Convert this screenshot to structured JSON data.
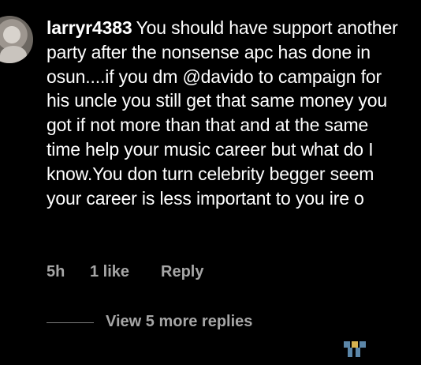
{
  "comment": {
    "username": "larryr4383",
    "text": "You should have support another party after the nonsense apc has done in osun....if you dm @davido to campaign for his uncle you still get that same money you got if not more than that  and at the same time help your music career but what do I know.You don turn celebrity begger seem your career is less important to you ire o"
  },
  "meta": {
    "time": "5h",
    "likes": "1 like",
    "reply": "Reply"
  },
  "replies": {
    "label": "View 5 more replies"
  },
  "icons": {
    "avatar": "profile-photo",
    "corner_glyph": "decorative-logo-icon"
  },
  "colors": {
    "background": "#000000",
    "text": "#ffffff",
    "muted": "#a6a6a6",
    "divider": "#7a7a7a"
  }
}
